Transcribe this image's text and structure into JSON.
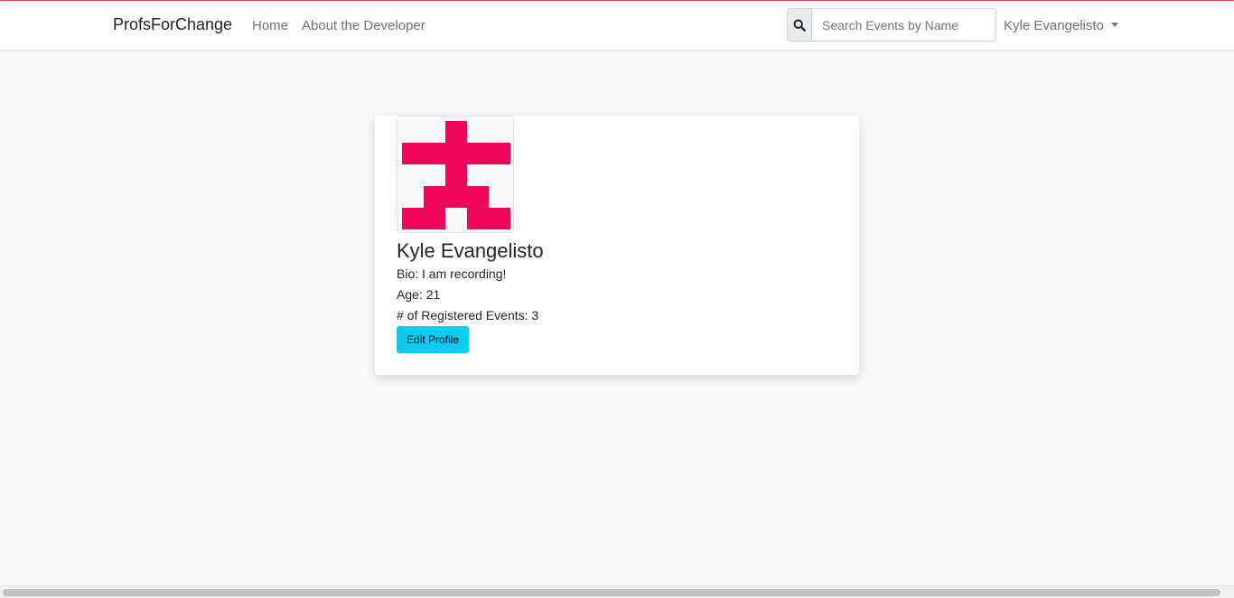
{
  "navbar": {
    "brand": "ProfsForChange",
    "links": [
      {
        "label": "Home"
      },
      {
        "label": "About the Developer"
      }
    ],
    "search": {
      "placeholder": "Search Events by Name",
      "value": "",
      "icon": "search-icon"
    },
    "user_menu": {
      "label": "Kyle Evangelisto",
      "icon": "caret-down-icon"
    }
  },
  "profile": {
    "name": "Kyle Evangelisto",
    "bio": "Bio: I am recording!",
    "age": "Age: 21",
    "registered_events": "# of Registered Events: 3",
    "edit_button": "Edit Profile",
    "avatar_color": "#f0065a"
  },
  "colors": {
    "accent_button": "#0dcaf0",
    "top_line": "#d9534f"
  }
}
